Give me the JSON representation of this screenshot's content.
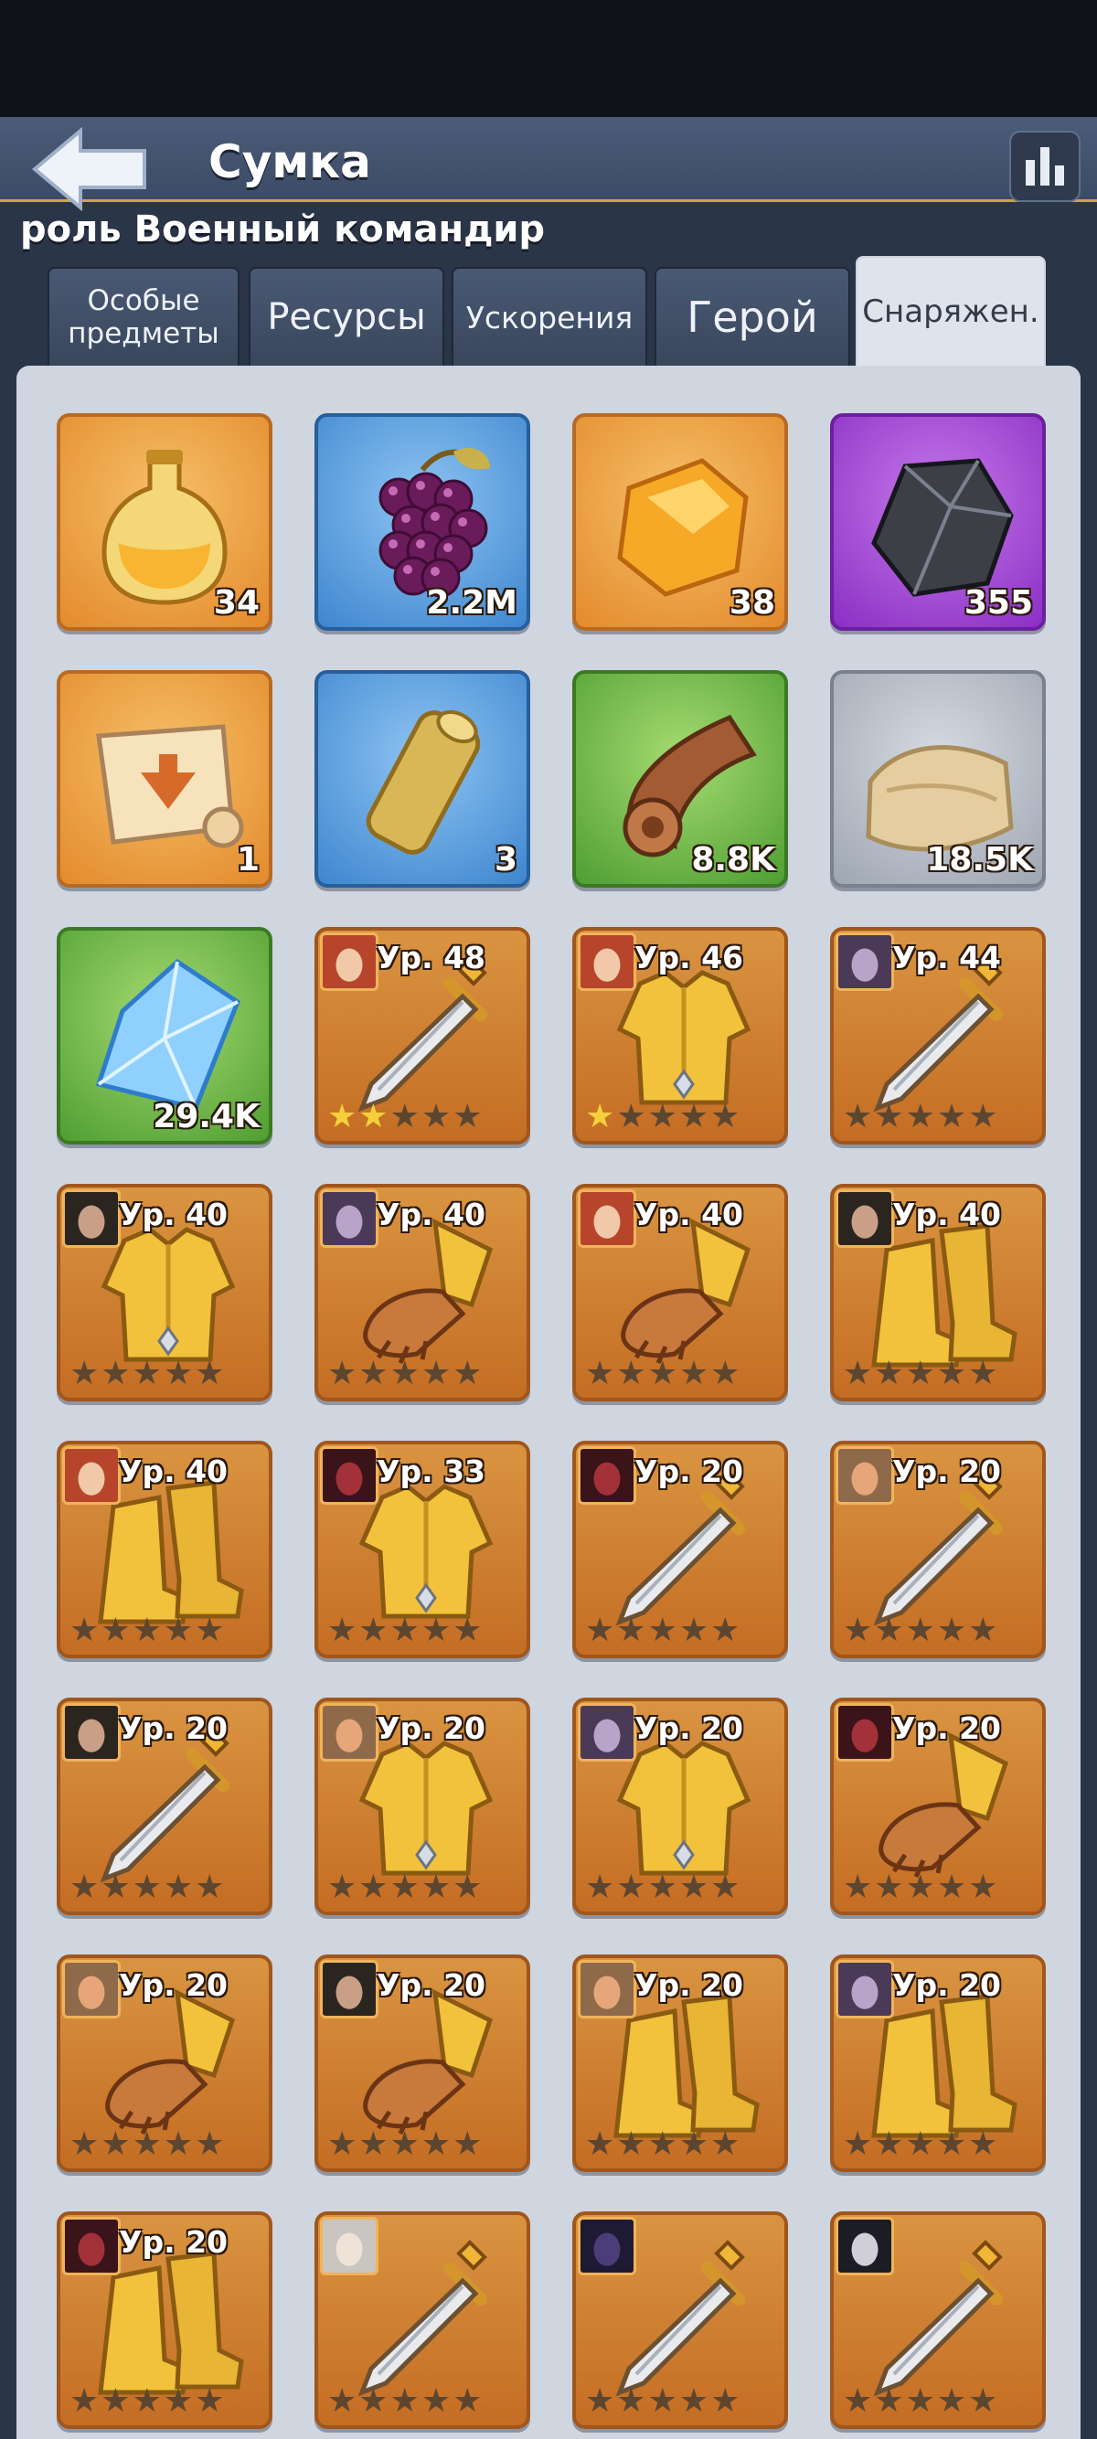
{
  "header": {
    "title": "Сумка",
    "subtitle": "роль Военный командир"
  },
  "tabs": [
    {
      "label": "Особые предметы",
      "active": false
    },
    {
      "label": "Ресурсы",
      "active": false
    },
    {
      "label": "Ускорения",
      "active": false
    },
    {
      "label": "Герой",
      "active": false
    },
    {
      "label": "Снаряжен.",
      "active": true
    }
  ],
  "colors": {
    "accent_gold": "#c9a54a",
    "panel_bg": "#cfd6e0",
    "header_bg": "#4b5c78"
  },
  "resources": [
    {
      "icon": "potion-icon",
      "rarity": "orange",
      "qty": "34"
    },
    {
      "icon": "grapes-icon",
      "rarity": "blue",
      "qty": "2.2M"
    },
    {
      "icon": "amber-icon",
      "rarity": "orange",
      "qty": "38"
    },
    {
      "icon": "ore-icon",
      "rarity": "purple",
      "qty": "355"
    },
    {
      "icon": "map-scroll-icon",
      "rarity": "orange",
      "qty": "1"
    },
    {
      "icon": "parchment-roll-icon",
      "rarity": "blue",
      "qty": "3"
    },
    {
      "icon": "leather-roll-icon",
      "rarity": "green",
      "qty": "8.8K"
    },
    {
      "icon": "cloth-icon",
      "rarity": "grey",
      "qty": "18.5K"
    },
    {
      "icon": "crystal-icon",
      "rarity": "green",
      "qty": "29.4K"
    }
  ],
  "equipment": [
    {
      "type": "sword",
      "level": "Ур. 48",
      "stars": 2,
      "hero": "red-hair-hero-portrait"
    },
    {
      "type": "armor",
      "level": "Ур. 46",
      "stars": 1,
      "hero": "red-hair-hero-portrait"
    },
    {
      "type": "sword",
      "level": "Ур. 44",
      "stars": 0,
      "hero": "dark-elf-hero-portrait"
    },
    {
      "type": "armor",
      "level": "Ур. 40",
      "stars": 0,
      "hero": "bearded-warrior-portrait"
    },
    {
      "type": "gauntlet",
      "level": "Ур. 40",
      "stars": 0,
      "hero": "dark-elf-hero-portrait"
    },
    {
      "type": "gauntlet",
      "level": "Ур. 40",
      "stars": 0,
      "hero": "red-hair-hero-portrait"
    },
    {
      "type": "boots",
      "level": "Ур. 40",
      "stars": 0,
      "hero": "bearded-warrior-portrait"
    },
    {
      "type": "boots",
      "level": "Ур. 40",
      "stars": 0,
      "hero": "red-hair-hero-portrait"
    },
    {
      "type": "armor",
      "level": "Ур. 33",
      "stars": 0,
      "hero": "masked-knight-portrait"
    },
    {
      "type": "sword",
      "level": "Ур. 20",
      "stars": 0,
      "hero": "masked-knight-portrait"
    },
    {
      "type": "sword",
      "level": "Ур. 20",
      "stars": 0,
      "hero": "dwarf-hero-portrait"
    },
    {
      "type": "sword",
      "level": "Ур. 20",
      "stars": 0,
      "hero": "bearded-warrior-portrait"
    },
    {
      "type": "armor",
      "level": "Ур. 20",
      "stars": 0,
      "hero": "dwarf-hero-portrait"
    },
    {
      "type": "armor",
      "level": "Ур. 20",
      "stars": 0,
      "hero": "dark-elf-hero-portrait"
    },
    {
      "type": "gauntlet",
      "level": "Ур. 20",
      "stars": 0,
      "hero": "masked-knight-portrait"
    },
    {
      "type": "gauntlet",
      "level": "Ур. 20",
      "stars": 0,
      "hero": "dwarf-hero-portrait"
    },
    {
      "type": "gauntlet",
      "level": "Ур. 20",
      "stars": 0,
      "hero": "bearded-warrior-portrait"
    },
    {
      "type": "boots",
      "level": "Ур. 20",
      "stars": 0,
      "hero": "dwarf-hero-portrait"
    },
    {
      "type": "boots",
      "level": "Ур. 20",
      "stars": 0,
      "hero": "dark-elf-hero-portrait"
    },
    {
      "type": "boots",
      "level": "Ур. 20",
      "stars": 0,
      "hero": "masked-knight-portrait"
    },
    {
      "type": "sword",
      "level": "",
      "stars": 0,
      "hero": "elf-hero-portrait"
    },
    {
      "type": "sword",
      "level": "",
      "stars": 0,
      "hero": "hooded-hero-portrait"
    },
    {
      "type": "sword",
      "level": "",
      "stars": 0,
      "hero": "vampire-hero-portrait"
    }
  ]
}
